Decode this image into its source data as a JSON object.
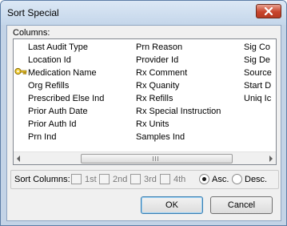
{
  "window": {
    "title": "Sort Special",
    "close_icon": "close-icon"
  },
  "columns": {
    "label": "Columns:",
    "col_a": [
      "Last Audit Type",
      "Location Id",
      "Medication Name",
      "Org Refills",
      "Prescribed Else Ind",
      "Prior Auth Date",
      "Prior Auth Id",
      "Prn Ind"
    ],
    "col_b": [
      "Prn Reason",
      "Provider Id",
      "Rx Comment",
      "Rx Quanity",
      "Rx Refills",
      "Rx Special Instruction",
      "Rx Units",
      "Samples Ind"
    ],
    "col_c": [
      "Sig Co",
      "Sig De",
      "Source",
      "Start D",
      "Uniq Ic"
    ],
    "selected_icon": "key-icon",
    "scroll_grip": "|||"
  },
  "options": {
    "sort_columns_label": "Sort Columns:",
    "checks": [
      "1st",
      "2nd",
      "3rd",
      "4th"
    ],
    "asc_label": "Asc.",
    "desc_label": "Desc.",
    "order": "asc"
  },
  "buttons": {
    "ok": "OK",
    "cancel": "Cancel"
  }
}
